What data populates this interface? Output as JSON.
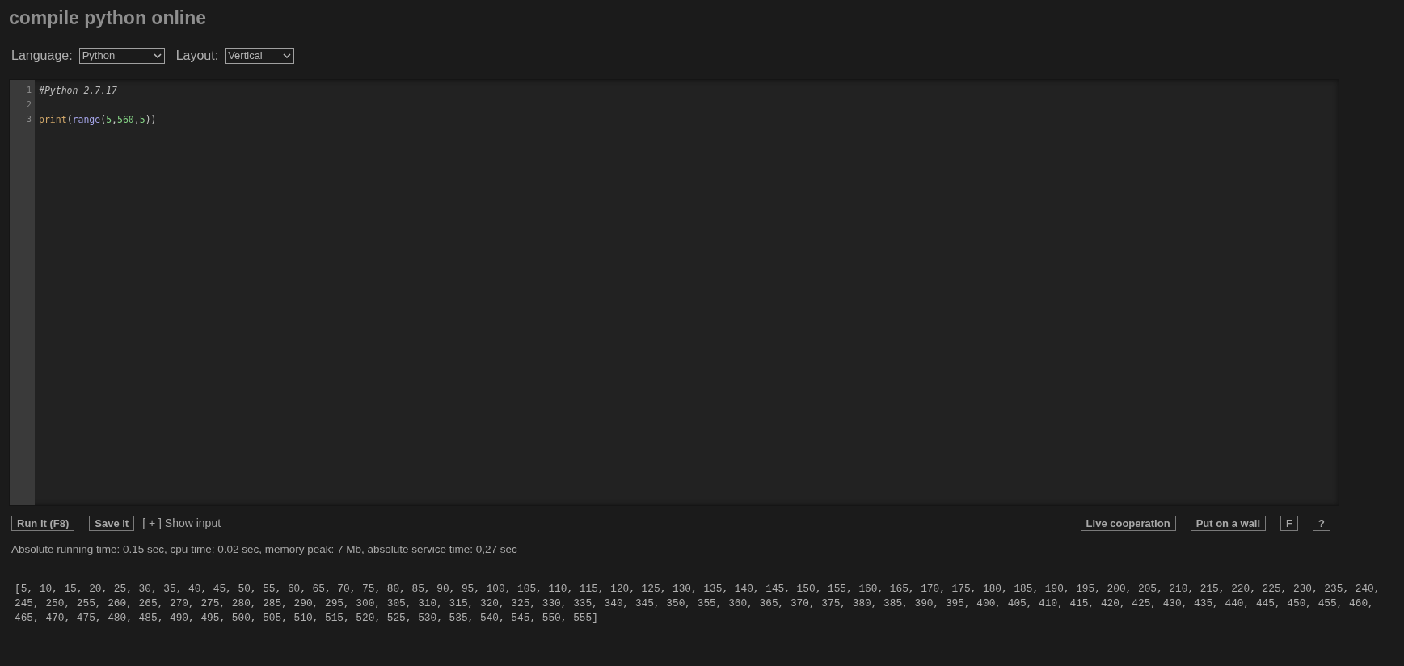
{
  "title": "compile python online",
  "toolbar": [
    {
      "label": "Language:",
      "value": "Python"
    },
    {
      "label": "Layout:",
      "value": "Vertical"
    }
  ],
  "editor": {
    "lines": [
      {
        "number": "1",
        "tokens": [
          {
            "kind": "comment",
            "text": "#Python 2.7.17"
          }
        ]
      },
      {
        "number": "2"
      },
      {
        "number": "3",
        "tokens": [
          {
            "kind": "builtin",
            "text": "print"
          },
          {
            "kind": "punct",
            "text": "("
          },
          {
            "kind": "function",
            "text": "range"
          },
          {
            "kind": "punct",
            "text": "("
          },
          {
            "kind": "number",
            "text": "5"
          },
          {
            "kind": "punct",
            "text": ","
          },
          {
            "kind": "number",
            "text": "560"
          },
          {
            "kind": "punct",
            "text": ","
          },
          {
            "kind": "number",
            "text": "5"
          },
          {
            "kind": "punct",
            "text": "))"
          }
        ]
      }
    ]
  },
  "actions_left": {
    "buttons": [
      "Run it (F8)",
      "Save it"
    ],
    "link": "[ + ] Show input"
  },
  "actions_right": [
    "Live cooperation",
    "Put on a wall",
    "F",
    "?"
  ],
  "stats": "Absolute running time: 0.15 sec, cpu time: 0.02 sec, memory peak: 7 Mb, absolute service time: 0,27 sec",
  "output": [
    "[5, 10, 15, 20, 25, 30, 35, 40, 45, 50, 55, 60, 65, 70, 75, 80, 85, 90, 95, 100, 105, 110, 115, 120, 125, 130, 135, 140, 145, 150, 155, 160, 165, 170, 175, 180, 185, 190, 195, 200, 205, 210, 215, 220, 225, 230, 235, 240,",
    "245, 250, 255, 260, 265, 270, 275, 280, 285, 290, 295, 300, 305, 310, 315, 320, 325, 330, 335, 340, 345, 350, 355, 360, 365, 370, 375, 380, 385, 390, 395, 400, 405, 410, 415, 420, 425, 430, 435, 440, 445, 450, 455, 460,",
    "465, 470, 475, 480, 485, 490, 495, 500, 505, 510, 515, 520, 525, 530, 535, 540, 545, 550, 555]"
  ]
}
